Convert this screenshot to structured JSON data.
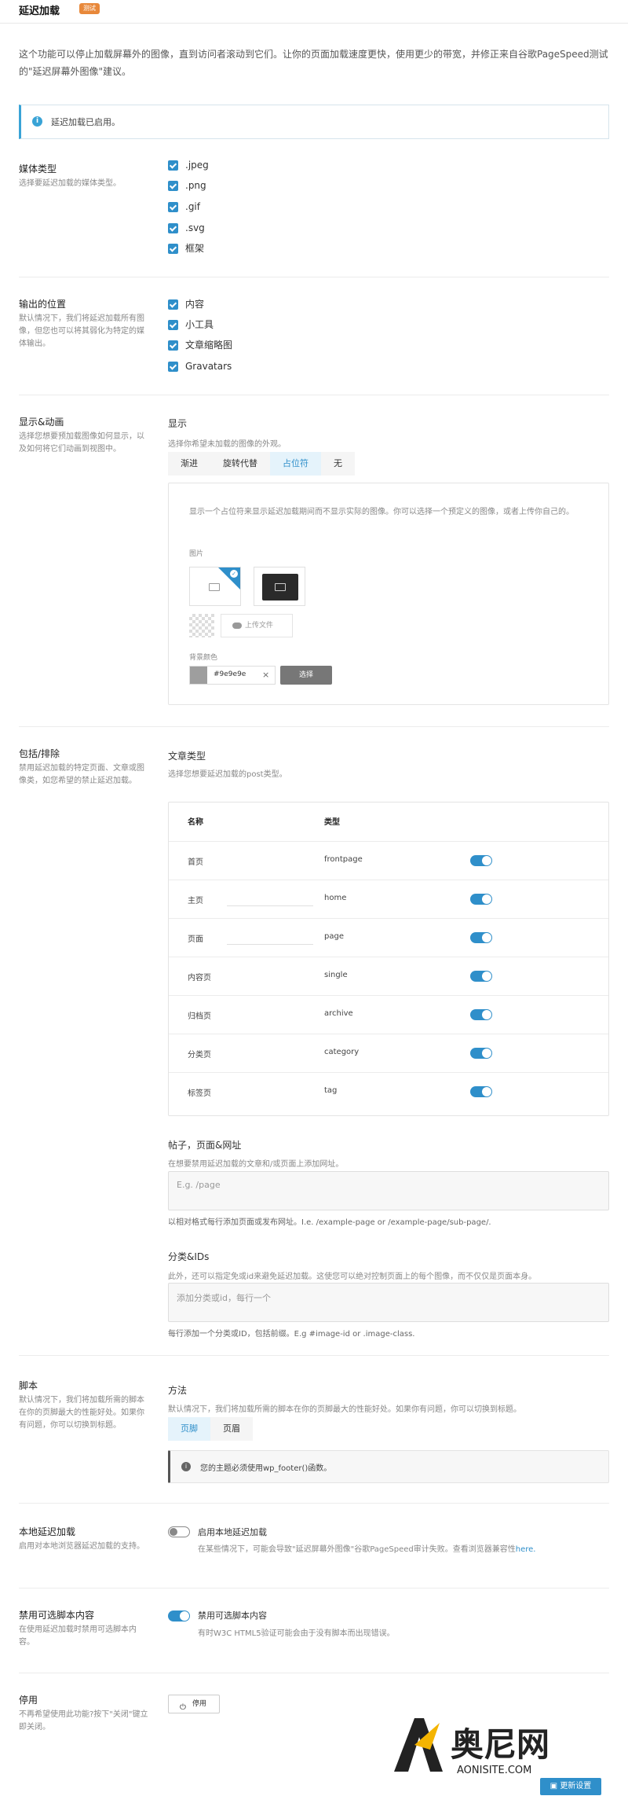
{
  "header": {
    "title": "延迟加载",
    "badge": "测试"
  },
  "intro": "这个功能可以停止加载屏幕外的图像，直到访问者滚动到它们。让你的页面加载速度更快，使用更少的带宽，并修正来自谷歌PageSpeed测试的\"延迟屏幕外图像\"建议。",
  "notice": "延迟加载已启用。",
  "media": {
    "title": "媒体类型",
    "desc": "选择要延迟加载的媒体类型。",
    "items": [
      ".jpeg",
      ".png",
      ".gif",
      ".svg",
      "框架"
    ]
  },
  "output": {
    "title": "输出的位置",
    "desc": "默认情况下，我们将延迟加载所有图像，但您也可以将其弱化为特定的媒体输出。",
    "items": [
      "内容",
      "小工具",
      "文章缩略图",
      "Gravatars"
    ]
  },
  "display": {
    "title": "显示&动画",
    "desc": "选择您想要预加载图像如何显示，以及如何将它们动画到视图中。",
    "label": "显示",
    "sub": "选择你希望未加载的图像的外观。",
    "tabs": [
      "渐进",
      "旋转代替",
      "占位符",
      "无"
    ],
    "box_desc": "显示一个占位符来显示延迟加载期间而不显示实际的图像。你可以选择一个预定义的图像，或者上传你自己的。",
    "image_label": "图片",
    "upload": "上传文件",
    "bg_label": "背景颜色",
    "color_value": "#9e9e9e",
    "clear": "×",
    "choose": "选择",
    "bg_color": "#9e9e9e"
  },
  "include": {
    "title": "包括/排除",
    "desc": "禁用延迟加载的特定页面、文章或图像类，如您希望的禁止延迟加载。",
    "post_types_label": "文章类型",
    "post_types_sub": "选择您想要延迟加载的post类型。",
    "col_name": "名称",
    "col_type": "类型",
    "rows": [
      {
        "name": "首页",
        "type": "frontpage"
      },
      {
        "name": "主页",
        "type": "home"
      },
      {
        "name": "页面",
        "type": "page"
      },
      {
        "name": "内容页",
        "type": "single"
      },
      {
        "name": "归档页",
        "type": "archive"
      },
      {
        "name": "分类页",
        "type": "category"
      },
      {
        "name": "标签页",
        "type": "tag"
      }
    ],
    "urls_label": "帖子，页面&网址",
    "urls_sub": "在想要禁用延迟加载的文章和/或页面上添加网址。",
    "urls_placeholder": "E.g. /page",
    "urls_hint": "以相对格式每行添加页面或发布网址。I.e. /example-page or /example-page/sub-page/.",
    "ids_label": "分类&IDs",
    "ids_sub": "此外，还可以指定免或id来避免延迟加载。这使您可以绝对控制页面上的每个图像，而不仅仅是页面本身。",
    "ids_placeholder": "添加分类或id，每行一个",
    "ids_hint": "每行添加一个分类或ID，包括前缀。E.g #image-id or .image-class."
  },
  "script": {
    "title": "脚本",
    "desc": "默认情况下，我们将加载所需的脚本在你的页脚最大的性能好处。如果你有问题，你可以切换到标题。",
    "label": "方法",
    "sub": "默认情况下，我们将加载所需的脚本在你的页脚最大的性能好处。如果你有问题，你可以切换到标题。",
    "tabs": [
      "页脚",
      "页眉"
    ],
    "note": "您的主题必须使用wp_footer()函数。"
  },
  "native": {
    "title": "本地延迟加载",
    "desc": "启用对本地浏览器延迟加载的支持。",
    "toggle_label": "启用本地延迟加载",
    "toggle_desc": "在某些情况下，可能会导致\"延迟屏幕外图像\"谷歌PageSpeed审计失败。查看浏览器兼容性",
    "link": "here."
  },
  "noscript": {
    "title": "禁用可选脚本内容",
    "desc": "在使用延迟加载时禁用可选脚本内容。",
    "toggle_label": "禁用可选脚本内容",
    "toggle_desc": "有时W3C HTML5验证可能会由于没有脚本而出现错误。"
  },
  "disable": {
    "title": "停用",
    "desc": "不再希望使用此功能?按下\"关闭\"键立即关闭。",
    "button": "停用"
  },
  "footer": {
    "save": "更新设置",
    "brand": "奥尼网",
    "brand_url": "AONISITE.COM"
  }
}
